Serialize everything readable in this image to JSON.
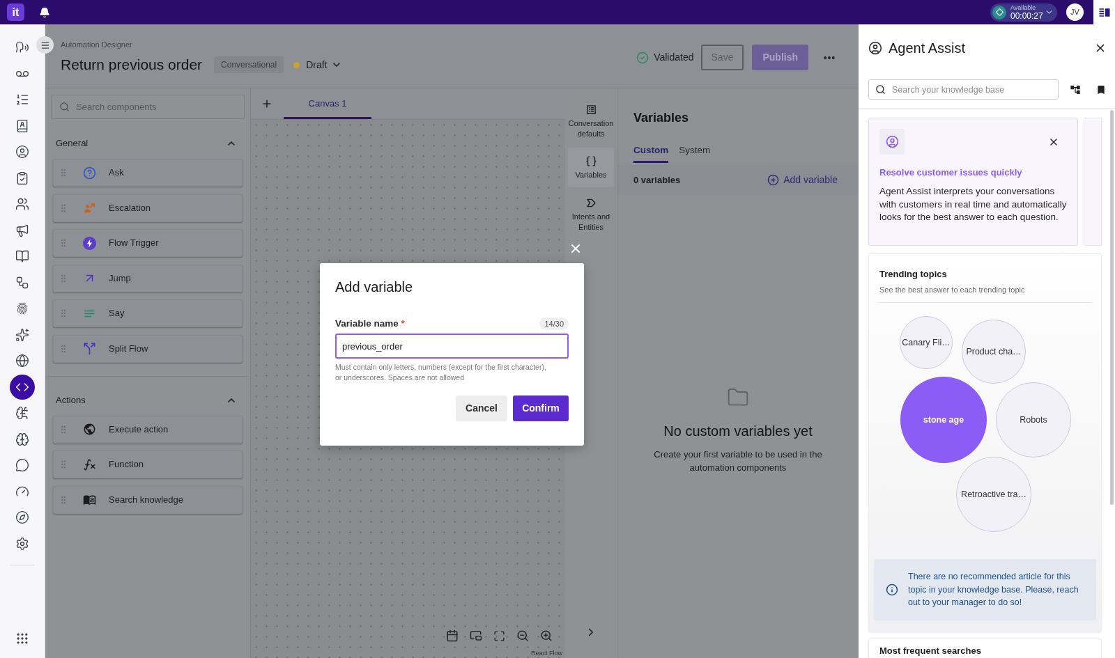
{
  "top_bar": {
    "logo": "it",
    "status": {
      "label": "Available",
      "timer": "00:00:27"
    },
    "avatar": "JV"
  },
  "nav_rail": {
    "items": [
      {
        "selected": false
      },
      {
        "selected": false
      },
      {
        "selected": false
      },
      {
        "selected": false
      },
      {
        "selected": false
      },
      {
        "selected": false
      },
      {
        "selected": false
      },
      {
        "selected": false
      },
      {
        "selected": false
      },
      {
        "selected": false
      },
      {
        "selected": false
      },
      {
        "selected": false
      },
      {
        "selected": false
      },
      {
        "selected": true
      },
      {
        "selected": false
      },
      {
        "selected": false
      },
      {
        "selected": false
      },
      {
        "selected": false
      },
      {
        "selected": false
      },
      {
        "selected": false
      }
    ]
  },
  "header": {
    "breadcrumb": "Automation Designer",
    "title": "Return previous order",
    "badge": "Conversational",
    "status": "Draft",
    "validation": "Validated",
    "buttons": [
      {
        "label": "Save",
        "kind": "outline"
      },
      {
        "label": "Publish",
        "kind": "primary"
      }
    ]
  },
  "components": {
    "search": {
      "placeholder": "Search components"
    },
    "sections": [
      {
        "title": "General",
        "expanded": true,
        "items": [
          {
            "label": "Ask",
            "kind": "ask"
          },
          {
            "label": "Escalation",
            "kind": "escalation"
          },
          {
            "label": "Flow Trigger",
            "kind": "trigger"
          },
          {
            "label": "Jump",
            "kind": "jump"
          },
          {
            "label": "Say",
            "kind": "say"
          },
          {
            "label": "Split Flow",
            "kind": "split"
          }
        ]
      },
      {
        "title": "Actions",
        "expanded": true,
        "items": [
          {
            "label": "Execute action",
            "kind": "action"
          },
          {
            "label": "Function",
            "kind": "function"
          },
          {
            "label": "Search knowledge",
            "kind": "knowledge"
          }
        ]
      }
    ]
  },
  "canvas": {
    "tabs": [
      {
        "label": "Canvas 1",
        "selected": true
      }
    ],
    "attribution": "React Flow"
  },
  "side_tools": [
    {
      "label": "Conversation defaults",
      "kind": "defaults",
      "selected": false
    },
    {
      "label": "Variables",
      "kind": "variables",
      "selected": true
    },
    {
      "label": "Intents and Entities",
      "kind": "intents",
      "selected": false
    }
  ],
  "variables_panel": {
    "title": "Variables",
    "tabs": [
      {
        "label": "Custom",
        "selected": true
      },
      {
        "label": "System",
        "selected": false
      }
    ],
    "count": "0 variables",
    "add_button": "Add variable",
    "empty_state": {
      "title": "No custom variables yet",
      "text": "Create your first variable to be used in the automation components"
    }
  },
  "dialog": {
    "title": "Add variable",
    "field": {
      "label": "Variable name",
      "required_mark": "*",
      "counter": "14/30",
      "value": "previous_order",
      "help": "Must contain only letters, numbers (except for the first character), or underscores. Spaces are not allowed"
    },
    "buttons": [
      {
        "label": "Cancel",
        "kind": "secondary"
      },
      {
        "label": "Confirm",
        "kind": "primary"
      }
    ]
  },
  "agent_assist": {
    "title": "Agent Assist",
    "search": {
      "placeholder": "Search your knowledge base"
    },
    "intro_card": {
      "title": "Resolve customer issues quickly",
      "text": "Agent Assist interprets your conversations with customers in real time and automatically looks for the best answer to each question."
    },
    "trending": {
      "title": "Trending topics",
      "subtitle": "See the best answer to each trending topic",
      "topics": [
        {
          "label": "Canary Fli…",
          "selected": false
        },
        {
          "label": "Product cha…",
          "selected": false
        },
        {
          "label": "stone age",
          "selected": true
        },
        {
          "label": "Robots",
          "selected": false
        },
        {
          "label": "Retroactive tra…",
          "selected": false
        }
      ]
    },
    "notice": "There are no recommended article for this topic in your knowledge base. Please, reach out to your manager to do so!",
    "next_section": "Most frequent searches"
  }
}
